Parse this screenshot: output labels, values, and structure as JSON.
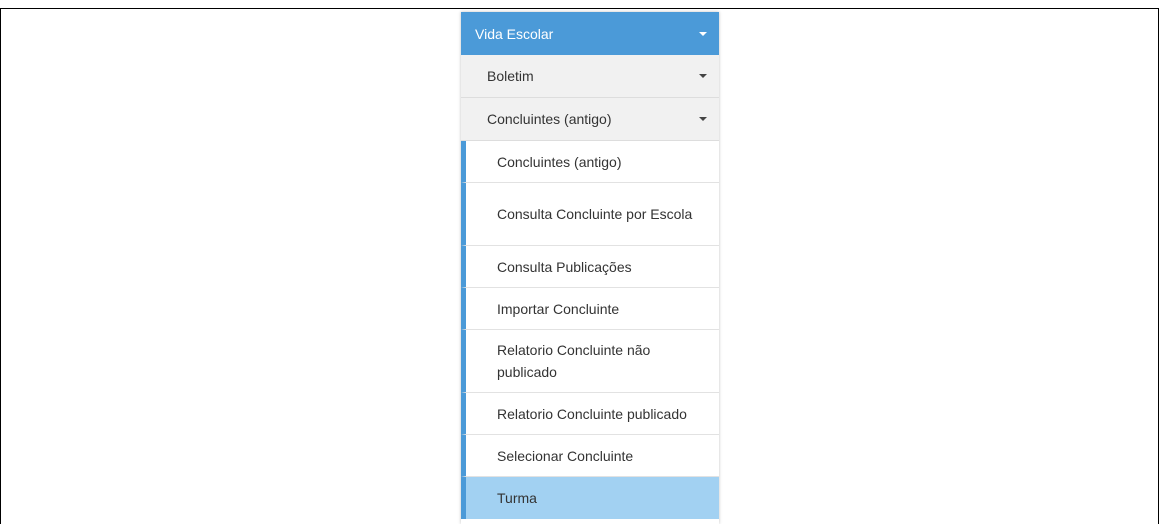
{
  "menu": {
    "title": "Vida Escolar",
    "groups": [
      {
        "label": "Boletim"
      },
      {
        "label": "Concluintes (antigo)"
      }
    ],
    "items": [
      {
        "label": "Concluintes (antigo)"
      },
      {
        "label": "Consulta Concluinte por Escola"
      },
      {
        "label": "Consulta Publicações"
      },
      {
        "label": "Importar Concluinte"
      },
      {
        "label": "Relatorio Concluinte não publicado"
      },
      {
        "label": "Relatorio Concluinte publicado"
      },
      {
        "label": "Selecionar Concluinte"
      },
      {
        "label": "Turma",
        "active": true
      }
    ]
  },
  "colors": {
    "accent": "#4b9ad8",
    "active_item_bg": "#a2d1f2",
    "group_bg": "#f1f1f1"
  }
}
